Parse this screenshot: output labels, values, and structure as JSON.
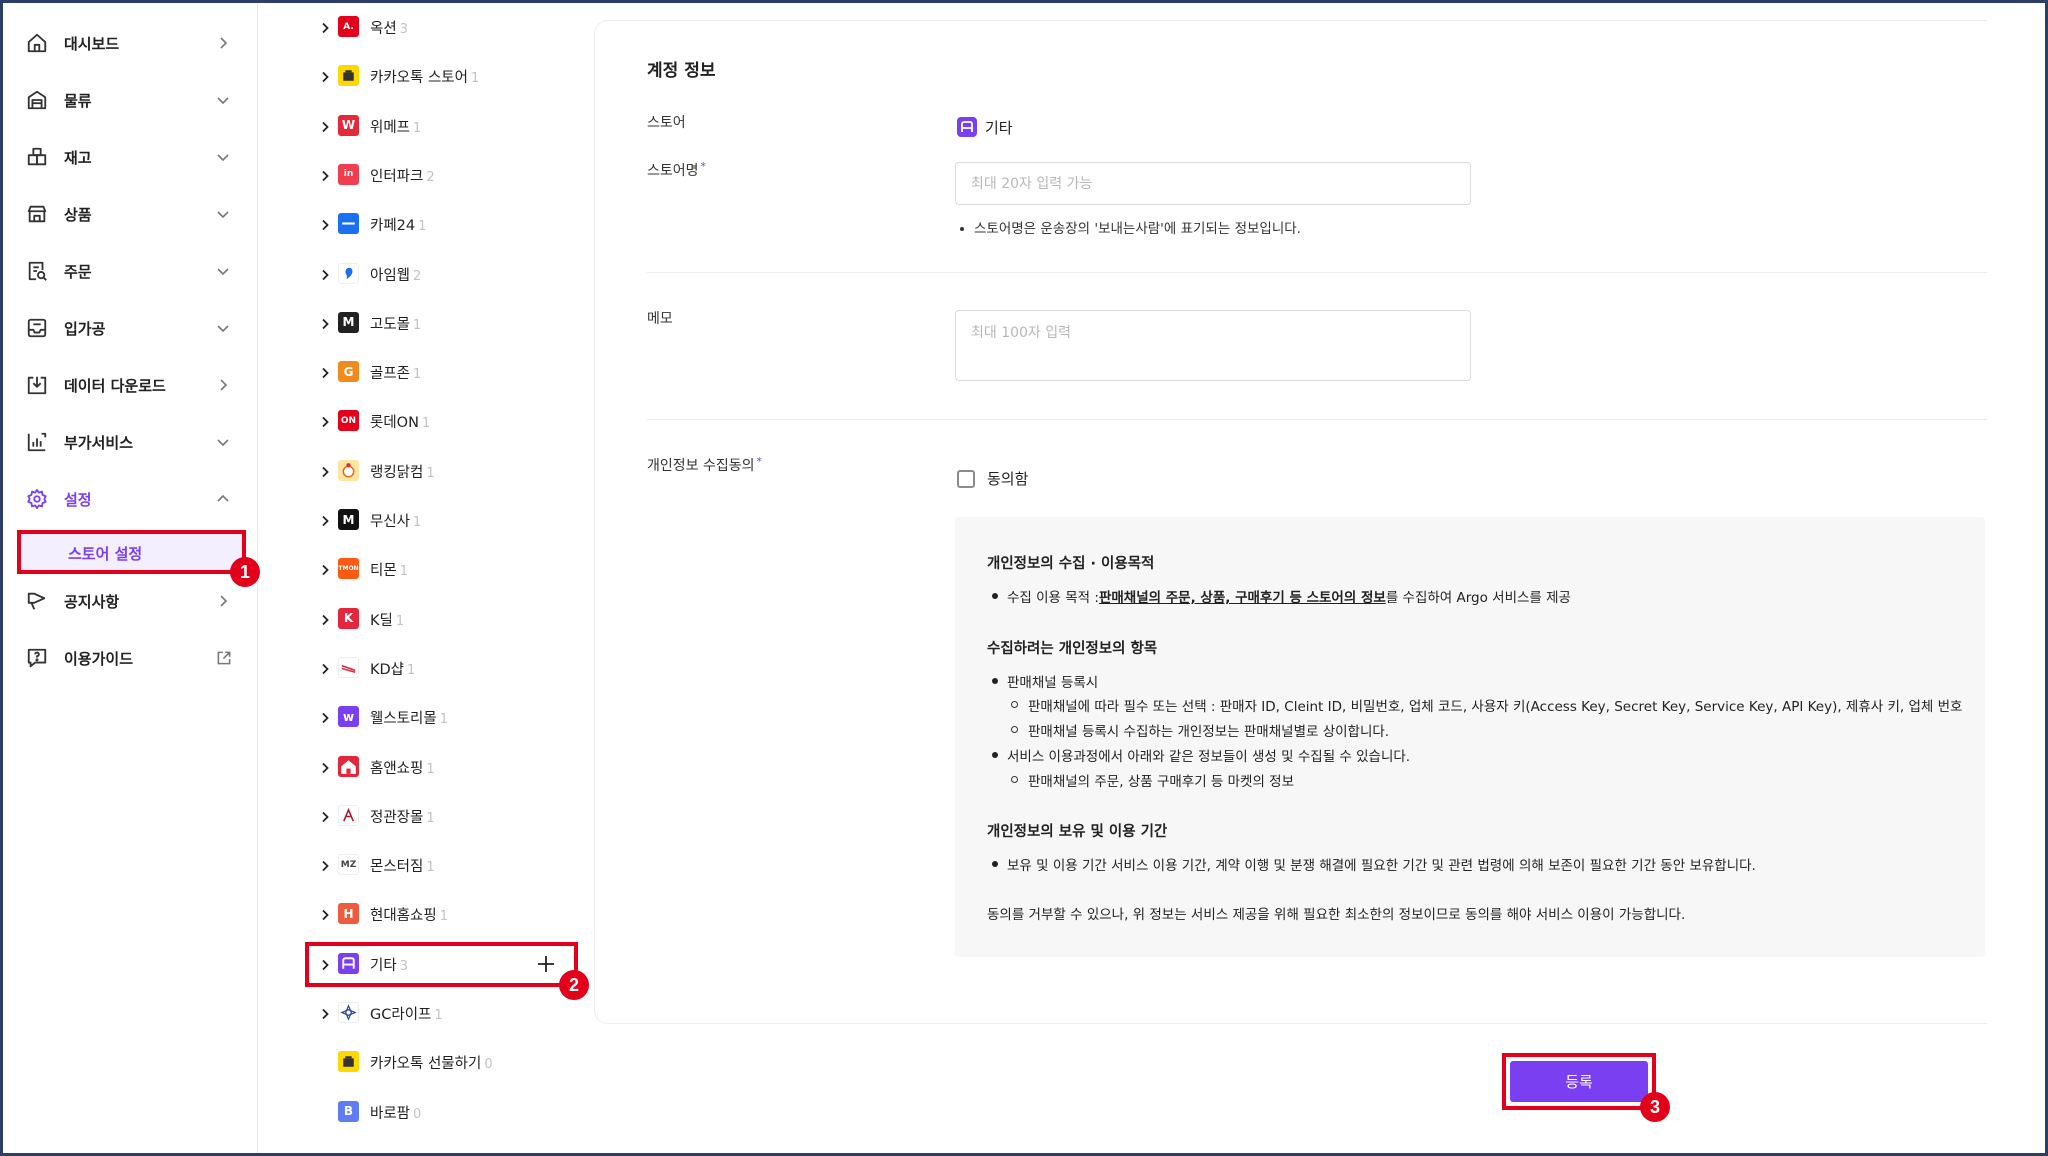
{
  "sidebar": {
    "items": [
      {
        "label": "대시보드",
        "icon": "home-icon",
        "chevron": "right"
      },
      {
        "label": "물류",
        "icon": "warehouse-icon",
        "chevron": "down"
      },
      {
        "label": "재고",
        "icon": "boxes-icon",
        "chevron": "down"
      },
      {
        "label": "상품",
        "icon": "store-icon",
        "chevron": "down"
      },
      {
        "label": "주문",
        "icon": "order-list-icon",
        "chevron": "down"
      },
      {
        "label": "입가공",
        "icon": "inbox-icon",
        "chevron": "down"
      },
      {
        "label": "데이터 다운로드",
        "icon": "download-icon",
        "chevron": "right"
      },
      {
        "label": "부가서비스",
        "icon": "service-chart-icon",
        "chevron": "down"
      },
      {
        "label": "설정",
        "icon": "gear-icon",
        "chevron": "up"
      },
      {
        "label": "공지사항",
        "icon": "megaphone-icon",
        "chevron": "right"
      },
      {
        "label": "이용가이드",
        "icon": "help-icon",
        "chevron": "external"
      }
    ],
    "sub_item_label": "스토어 설정"
  },
  "stores": [
    {
      "name": "옥션",
      "count": "3",
      "logo": "auction-logo",
      "logo_text": "A.",
      "color": "#e3001b"
    },
    {
      "name": "카카오톡 스토어",
      "count": "1",
      "logo": "kakao-store-logo",
      "logo_text": "",
      "color": "#ffd800"
    },
    {
      "name": "위메프",
      "count": "1",
      "logo": "wemakeprice-logo",
      "logo_text": "W",
      "color": "#e5283a"
    },
    {
      "name": "인터파크",
      "count": "2",
      "logo": "interpark-logo",
      "logo_text": "in",
      "color": "#ee3e4f"
    },
    {
      "name": "카페24",
      "count": "1",
      "logo": "cafe24-logo",
      "logo_text": "",
      "color": "#1a6ff2"
    },
    {
      "name": "아임웹",
      "count": "2",
      "logo": "imweb-logo",
      "logo_text": "",
      "color": "#ffffff"
    },
    {
      "name": "고도몰",
      "count": "1",
      "logo": "godomall-logo",
      "logo_text": "M",
      "color": "#222222"
    },
    {
      "name": "골프존",
      "count": "1",
      "logo": "golfzon-logo",
      "logo_text": "G",
      "color": "#f28b1e"
    },
    {
      "name": "롯데ON",
      "count": "1",
      "logo": "lotteon-logo",
      "logo_text": "ON",
      "color": "#e3001b"
    },
    {
      "name": "랭킹닭컴",
      "count": "1",
      "logo": "rankingdak-logo",
      "logo_text": "",
      "color": "#ffe6a0"
    },
    {
      "name": "무신사",
      "count": "1",
      "logo": "musinsa-logo",
      "logo_text": "M",
      "color": "#111111"
    },
    {
      "name": "티몬",
      "count": "1",
      "logo": "tmon-logo",
      "logo_text": "TMON",
      "color": "#ff5a14"
    },
    {
      "name": "K딜",
      "count": "1",
      "logo": "kdeal-logo",
      "logo_text": "K",
      "color": "#e3263b"
    },
    {
      "name": "KD샵",
      "count": "1",
      "logo": "kdshop-logo",
      "logo_text": "",
      "color": "#ffffff"
    },
    {
      "name": "웰스토리몰",
      "count": "1",
      "logo": "welstory-logo",
      "logo_text": "w",
      "color": "#7b3ff2"
    },
    {
      "name": "홈앤쇼핑",
      "count": "1",
      "logo": "homeandshopping-logo",
      "logo_text": "",
      "color": "#e3263b"
    },
    {
      "name": "정관장몰",
      "count": "1",
      "logo": "jungkwanjang-logo",
      "logo_text": "",
      "color": "#ffffff"
    },
    {
      "name": "몬스터짐",
      "count": "1",
      "logo": "monstergym-logo",
      "logo_text": "MZ",
      "color": "#ffffff"
    },
    {
      "name": "현대홈쇼핑",
      "count": "1",
      "logo": "hyundai-homeshopping-logo",
      "logo_text": "H",
      "color": "#ef5b3f"
    },
    {
      "name": "기타",
      "count": "3",
      "logo": "etc-logo",
      "logo_text": "",
      "color": "#7b3ff2"
    },
    {
      "name": "GC라이프",
      "count": "1",
      "logo": "gclife-logo",
      "logo_text": "",
      "color": "#ffffff"
    },
    {
      "name": "카카오톡 선물하기",
      "count": "0",
      "logo": "kakao-gift-logo",
      "logo_text": "",
      "color": "#ffd800"
    },
    {
      "name": "바로팜",
      "count": "0",
      "logo": "baropharm-logo",
      "logo_text": "B",
      "color": "#5f7df2"
    }
  ],
  "badges": [
    "1",
    "2",
    "3"
  ],
  "form": {
    "section_title": "계정 정보",
    "store_label": "스토어",
    "store_value": "기타",
    "store_name_label": "스토어명",
    "required_mark": "*",
    "store_name_placeholder": "최대 20자 입력 가능",
    "store_name_hint": "스토어명은 운송장의 '보내는사람'에 표기되는 정보입니다.",
    "memo_label": "메모",
    "memo_placeholder": "최대 100자 입력",
    "consent_label": "개인정보 수집동의",
    "agree_label": "동의함",
    "submit_label": "등록"
  },
  "consent": {
    "heading1": "개인정보의 수집 · 이용목적",
    "purpose_prefix": "수집 이용 목적 :",
    "purpose_bold": "판매채널의 주문, 상품, 구매후기 등 스토어의 정보",
    "purpose_suffix": "를 수집하여 Argo 서비스를 제공",
    "heading2": "수집하려는 개인정보의 항목",
    "item1": "판매채널 등록시",
    "item1_sub1": "판매채널에 따라 필수 또는 선택 : 판매자 ID, Cleint ID, 비밀번호, 업체 코드, 사용자 키(Access Key, Secret Key, Service Key, API Key), 제휴사 키, 업체 번호",
    "item1_sub2": "판매채널 등록시 수집하는 개인정보는 판매채널별로 상이합니다.",
    "item2": "서비스 이용과정에서 아래와 같은 정보들이 생성 및 수집될 수 있습니다.",
    "item2_sub1": "판매채널의 주문, 상품 구매후기 등 마켓의 정보",
    "heading3": "개인정보의 보유 및 이용 기간",
    "retention": "보유 및 이용 기간 서비스 이용 기간, 계약 이행 및 분쟁 해결에 필요한 기간 및 관련 법령에 의해 보존이 필요한 기간 동안 보유합니다.",
    "footer": "동의를 거부할 수 있으나, 위 정보는 서비스 제공을 위해 필요한 최소한의 정보이므로 동의를 해야 서비스 이용이 가능합니다."
  }
}
